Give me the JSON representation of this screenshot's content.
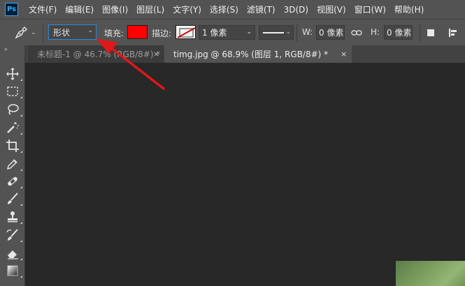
{
  "app": {
    "logo_text": "Ps"
  },
  "menu": [
    "文件(F)",
    "编辑(E)",
    "图像(I)",
    "图层(L)",
    "文字(Y)",
    "选择(S)",
    "滤镜(T)",
    "3D(D)",
    "视图(V)",
    "窗口(W)",
    "帮助(H)"
  ],
  "options": {
    "shape_mode": "形状",
    "fill_label": "填充:",
    "fill_color": "#ff0000",
    "stroke_label": "描边:",
    "stroke_width": "1 像素",
    "w_label": "W:",
    "w_value": "0 像素",
    "h_label": "H:",
    "h_value": "0 像素"
  },
  "tabs": [
    {
      "label": "未标题-1 @ 46.7% (RGB/8#) *",
      "close": "×",
      "active": false
    },
    {
      "label": "timg.jpg @ 68.9% (图层 1, RGB/8#) *",
      "close": "×",
      "active": true
    }
  ],
  "toolbar": {
    "collapse": "»",
    "tools": [
      "move-tool",
      "marquee-tool",
      "lasso-tool",
      "magic-wand-tool",
      "crop-tool",
      "eyedropper-tool",
      "healing-brush-tool",
      "brush-tool",
      "clone-stamp-tool",
      "history-brush-tool",
      "eraser-tool",
      "gradient-tool"
    ]
  },
  "annotation": {
    "color": "#e01818"
  }
}
